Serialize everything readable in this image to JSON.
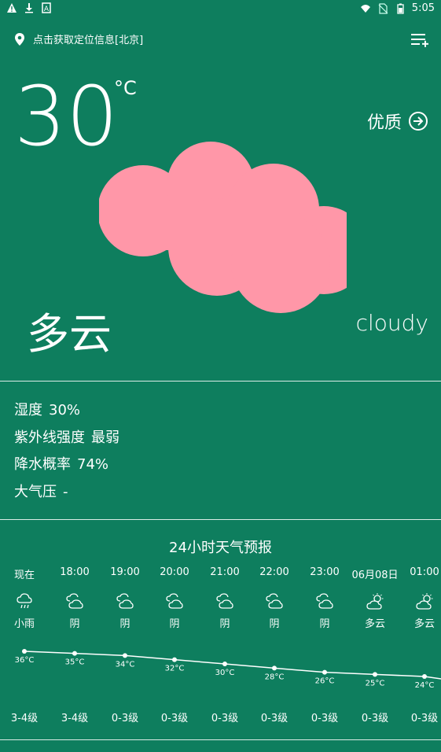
{
  "status_bar": {
    "time": "5:05",
    "left_icons": [
      "warning-icon",
      "download-icon",
      "notification-icon"
    ],
    "right_icons": [
      "wifi-icon",
      "no-sim-icon",
      "battery-icon"
    ]
  },
  "location": {
    "text": "点击获取定位信息[北京]"
  },
  "current": {
    "temperature": "30",
    "unit": "°C",
    "air_quality": "优质",
    "condition_cn": "多云",
    "condition_en": "cloudy",
    "cloud_color": "#ff97a8"
  },
  "details": [
    {
      "label": "湿度",
      "value": "30%"
    },
    {
      "label": "紫外线强度",
      "value": "最弱"
    },
    {
      "label": "降水概率",
      "value": "74%"
    },
    {
      "label": "大气压",
      "value": "-"
    }
  ],
  "hourly": {
    "title": "24小时天气预报",
    "items": [
      {
        "time": "现在",
        "icon": "rain-icon",
        "desc": "小雨",
        "temp": "36°C",
        "temp_value": 36,
        "level": "3-4级"
      },
      {
        "time": "18:00",
        "icon": "overcast-icon",
        "desc": "阴",
        "temp": "35°C",
        "temp_value": 35,
        "level": "3-4级"
      },
      {
        "time": "19:00",
        "icon": "overcast-icon",
        "desc": "阴",
        "temp": "34°C",
        "temp_value": 34,
        "level": "0-3级"
      },
      {
        "time": "20:00",
        "icon": "overcast-icon",
        "desc": "阴",
        "temp": "32°C",
        "temp_value": 32,
        "level": "0-3级"
      },
      {
        "time": "21:00",
        "icon": "overcast-icon",
        "desc": "阴",
        "temp": "30°C",
        "temp_value": 30,
        "level": "0-3级"
      },
      {
        "time": "22:00",
        "icon": "overcast-icon",
        "desc": "阴",
        "temp": "28°C",
        "temp_value": 28,
        "level": "0-3级"
      },
      {
        "time": "23:00",
        "icon": "overcast-icon",
        "desc": "阴",
        "temp": "26°C",
        "temp_value": 26,
        "level": "0-3级"
      },
      {
        "time": "06月08日",
        "icon": "partly-cloudy-icon",
        "desc": "多云",
        "temp": "25°C",
        "temp_value": 25,
        "level": "0-3级"
      },
      {
        "time": "01:00",
        "icon": "partly-cloudy-icon",
        "desc": "多云",
        "temp": "24°C",
        "temp_value": 24,
        "level": "0-3级"
      }
    ]
  }
}
